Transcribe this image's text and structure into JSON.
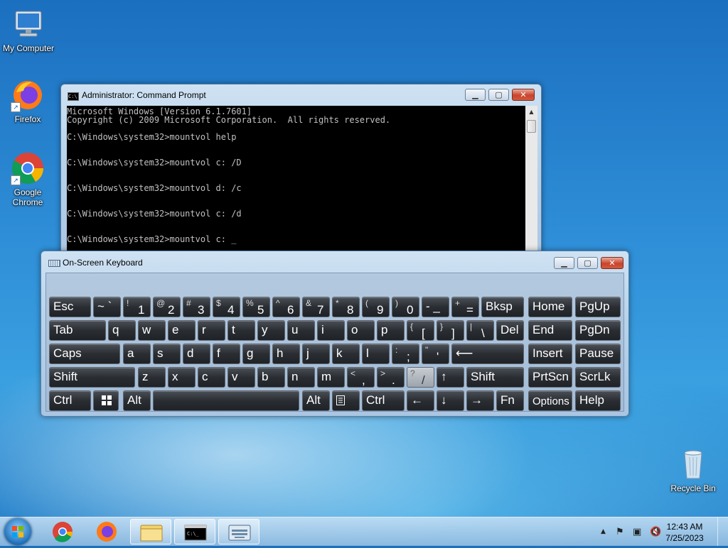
{
  "desktop": {
    "icons": [
      {
        "label": "My Computer"
      },
      {
        "label": "Firefox"
      },
      {
        "label": "Google Chrome"
      },
      {
        "label": "Recycle Bin"
      }
    ]
  },
  "cmd_window": {
    "title": "Administrator: Command Prompt",
    "lines": [
      "Microsoft Windows [Version 6.1.7601]",
      "Copyright (c) 2009 Microsoft Corporation.  All rights reserved.",
      "",
      "C:\\Windows\\system32>mountvol help",
      "",
      "",
      "C:\\Windows\\system32>mountvol c: /D",
      "",
      "",
      "C:\\Windows\\system32>mountvol d: /c",
      "",
      "",
      "C:\\Windows\\system32>mountvol c: /d",
      "",
      "",
      "C:\\Windows\\system32>mountvol c: _"
    ]
  },
  "osk_window": {
    "title": "On-Screen Keyboard",
    "rows": [
      [
        {
          "main": "Esc"
        },
        {
          "main": "~ `"
        },
        {
          "top": "!",
          "bottom": "1"
        },
        {
          "top": "@",
          "bottom": "2"
        },
        {
          "top": "#",
          "bottom": "3"
        },
        {
          "top": "$",
          "bottom": "4"
        },
        {
          "top": "%",
          "bottom": "5"
        },
        {
          "top": "^",
          "bottom": "6"
        },
        {
          "top": "&",
          "bottom": "7"
        },
        {
          "top": "*",
          "bottom": "8"
        },
        {
          "top": "(",
          "bottom": "9"
        },
        {
          "top": ")",
          "bottom": "0"
        },
        {
          "main": "- _"
        },
        {
          "top": "+",
          "bottom": "="
        },
        {
          "main": "Bksp"
        },
        {
          "main": "Home"
        },
        {
          "main": "PgUp"
        }
      ],
      [
        {
          "main": "Tab"
        },
        {
          "main": "q"
        },
        {
          "main": "w"
        },
        {
          "main": "e"
        },
        {
          "main": "r"
        },
        {
          "main": "t"
        },
        {
          "main": "y"
        },
        {
          "main": "u"
        },
        {
          "main": "i"
        },
        {
          "main": "o"
        },
        {
          "main": "p"
        },
        {
          "top": "{",
          "bottom": "["
        },
        {
          "top": "}",
          "bottom": "]"
        },
        {
          "top": "|",
          "bottom": "\\"
        },
        {
          "main": "Del"
        },
        {
          "main": "End"
        },
        {
          "main": "PgDn"
        }
      ],
      [
        {
          "main": "Caps"
        },
        {
          "main": "a"
        },
        {
          "main": "s"
        },
        {
          "main": "d"
        },
        {
          "main": "f"
        },
        {
          "main": "g"
        },
        {
          "main": "h"
        },
        {
          "main": "j"
        },
        {
          "main": "k"
        },
        {
          "main": "l"
        },
        {
          "top": ":",
          "bottom": ";"
        },
        {
          "top": "\"",
          "bottom": "'"
        },
        {
          "main": "⟵"
        },
        {
          "main": "Insert"
        },
        {
          "main": "Pause"
        }
      ],
      [
        {
          "main": "Shift"
        },
        {
          "main": "z"
        },
        {
          "main": "x"
        },
        {
          "main": "c"
        },
        {
          "main": "v"
        },
        {
          "main": "b"
        },
        {
          "main": "n"
        },
        {
          "main": "m"
        },
        {
          "top": "<",
          "bottom": ","
        },
        {
          "top": ">",
          "bottom": "."
        },
        {
          "top": "?",
          "bottom": "/"
        },
        {
          "main": "↑"
        },
        {
          "main": "Shift"
        },
        {
          "main": "PrtScn"
        },
        {
          "main": "ScrLk"
        }
      ],
      [
        {
          "main": "Ctrl"
        },
        {
          "main": "win-logo"
        },
        {
          "main": "Alt"
        },
        {
          "main": ""
        },
        {
          "main": "Alt"
        },
        {
          "main": "menu-icon"
        },
        {
          "main": "Ctrl"
        },
        {
          "main": "←"
        },
        {
          "main": "↓"
        },
        {
          "main": "→"
        },
        {
          "main": "Fn"
        },
        {
          "main": "Options"
        },
        {
          "main": "Help"
        }
      ]
    ]
  },
  "taskbar": {
    "items": [
      "start-button",
      "chrome-icon",
      "firefox-icon",
      "explorer-icon",
      "cmd-icon",
      "osk-icon"
    ],
    "tray_arrow": "▲",
    "time": "12:43 AM",
    "date": "7/25/2023"
  }
}
